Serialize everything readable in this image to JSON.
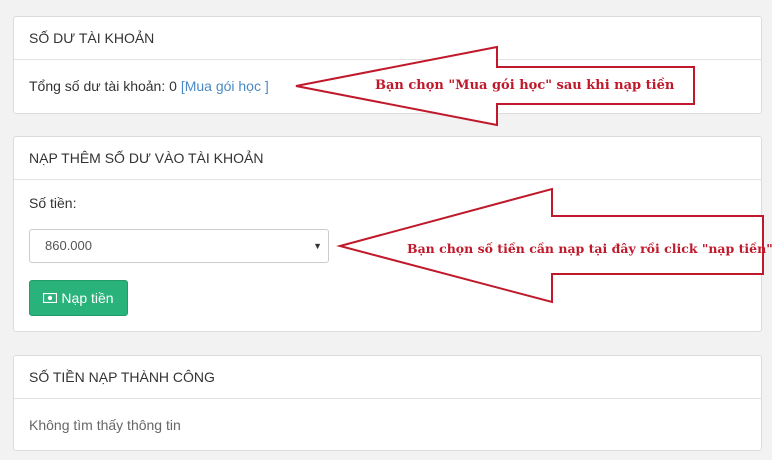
{
  "balance_panel": {
    "title": "SỐ DƯ TÀI KHOẢN",
    "total_label": "Tổng số dư tài khoản:",
    "total_value": "0",
    "buy_link_open": "[",
    "buy_link_text": "Mua gói học",
    "buy_link_close": "]"
  },
  "topup_panel": {
    "title": "NẠP THÊM SỐ DƯ VÀO TÀI KHOẢN",
    "amount_label": "Số tiền:",
    "amount_selected": "860.000",
    "submit_label": "Nạp tiền",
    "submit_icon": "money-bill-icon"
  },
  "history_panel": {
    "title": "SỐ TIỀN NẠP THÀNH CÔNG",
    "empty_text": "Không tìm thấy thông tin"
  },
  "annotations": {
    "arrow1_text": "Bạn chọn \"Mua gói học\" sau khi nạp tiền",
    "arrow2_text": "Bạn chọn số tiền cần nạp tại đây rồi click \"nạp tiền\"",
    "color": "#c0192b"
  }
}
